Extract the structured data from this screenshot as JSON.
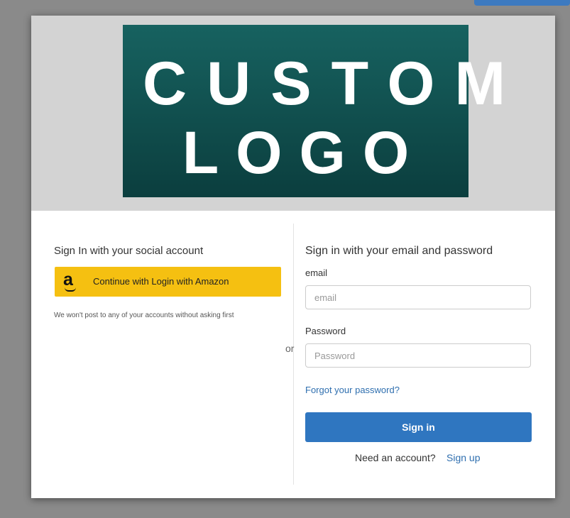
{
  "logo": {
    "line1": "CUSTOM",
    "line2": "LOGO"
  },
  "social": {
    "title": "Sign In with your social account",
    "amazon_logo": "a",
    "amazon_button_label": "Continue with Login with Amazon",
    "note": "We won't post to any of your accounts without asking first"
  },
  "separator": "or",
  "email_login": {
    "title": "Sign in with your email and password",
    "email_label": "email",
    "email_placeholder": "email",
    "password_label": "Password",
    "password_placeholder": "Password",
    "forgot_link": "Forgot your password?",
    "signin_button": "Sign in",
    "need_account_text": "Need an account?",
    "signup_link": "Sign up"
  },
  "colors": {
    "amazon_button": "#f5c011",
    "primary_button": "#2f76c0",
    "link": "#2f6faf",
    "logo_bg": "#125453"
  }
}
